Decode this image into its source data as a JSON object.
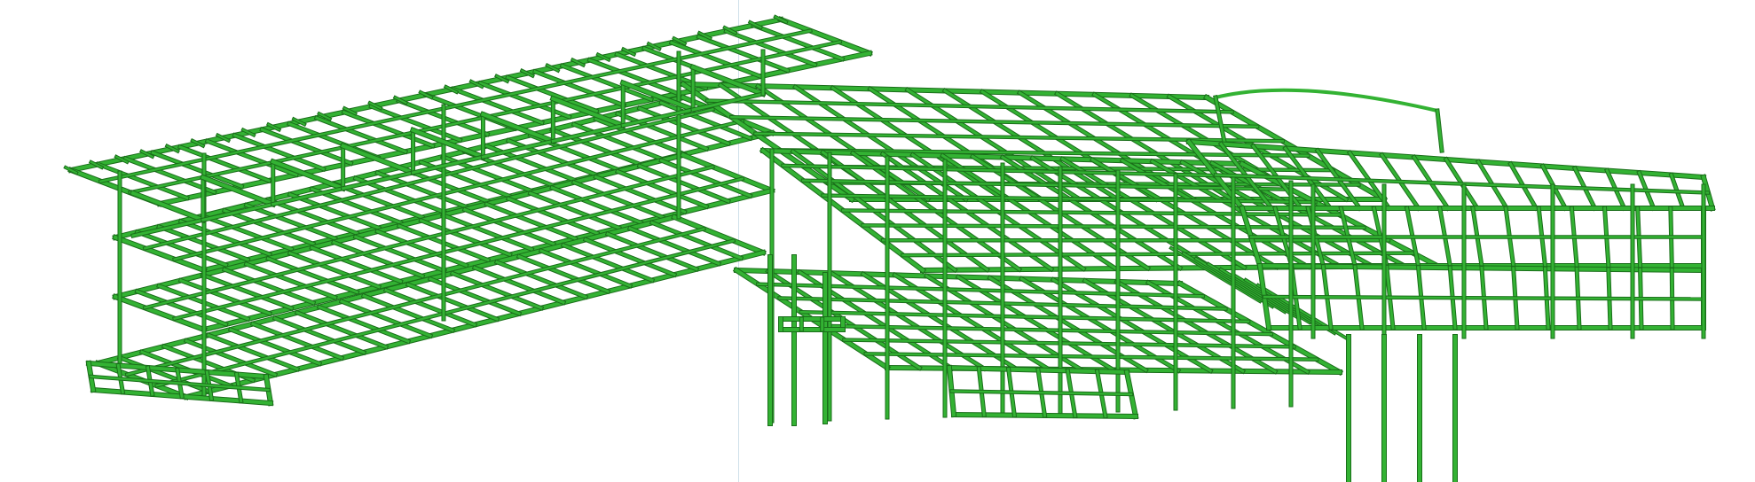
{
  "viewport": {
    "background": "#ffffff",
    "guide_color": "#cfe0ea"
  },
  "model": {
    "kind": "3d-structural-steel-frame",
    "member_fill": "#33b233",
    "member_stroke": "#1a6e1a",
    "member_highlight": "#5fd45f",
    "connection_color": "#7a8a7a"
  }
}
